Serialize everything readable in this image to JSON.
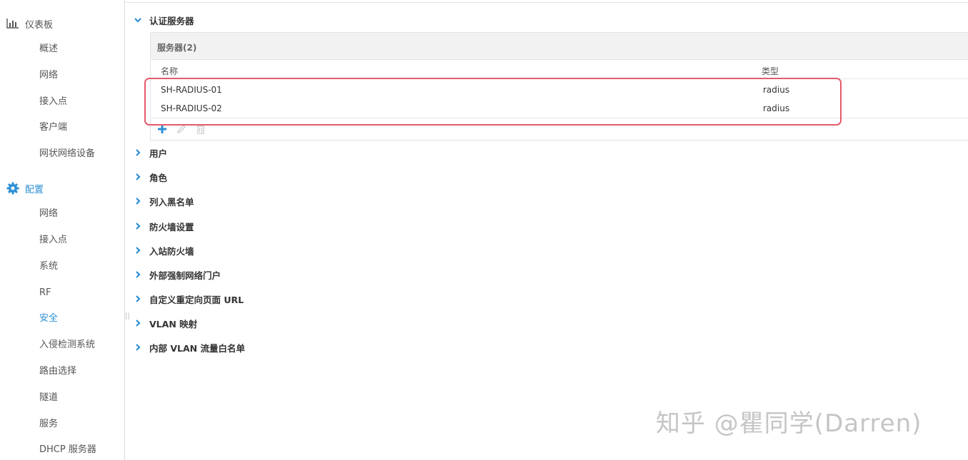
{
  "sidebar": {
    "dashboard": {
      "label": "仪表板",
      "icon": "bar-chart-icon",
      "items": [
        "概述",
        "网络",
        "接入点",
        "客户端",
        "网状网络设备"
      ]
    },
    "config": {
      "label": "配置",
      "icon": "gear-icon",
      "items": [
        "网络",
        "接入点",
        "系统",
        "RF",
        "安全",
        "入侵检测系统",
        "路由选择",
        "隧道",
        "服务",
        "DHCP 服务器"
      ],
      "active_item": "安全"
    }
  },
  "main": {
    "auth_servers": {
      "title": "认证服务器",
      "expanded": true,
      "panel_title": "服务器(2)",
      "columns": [
        "名称",
        "类型"
      ],
      "rows": [
        {
          "name": "SH-RADIUS-01",
          "type": "radius"
        },
        {
          "name": "SH-RADIUS-02",
          "type": "radius"
        }
      ],
      "tools": [
        "add-icon",
        "edit-icon",
        "delete-icon"
      ]
    },
    "sections": [
      "用户",
      "角色",
      "列入黑名单",
      "防火墙设置",
      "入站防火墙",
      "外部强制网络门户",
      "自定义重定向页面 URL",
      "VLAN 映射",
      "内部 VLAN 流量白名单"
    ]
  },
  "watermark": "知乎 @瞿同学(Darren)",
  "colors": {
    "accent": "#2d8fd5",
    "highlight": "#e45a6a",
    "panel_header": "#f2f2f2"
  }
}
